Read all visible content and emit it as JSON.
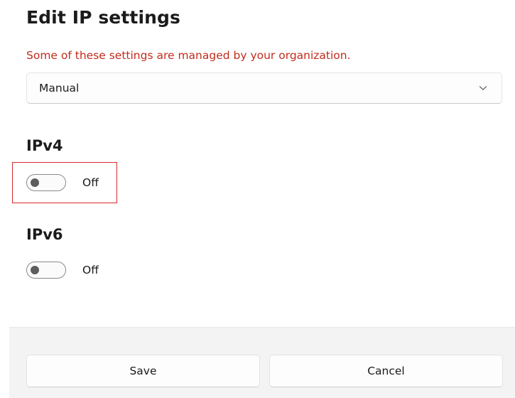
{
  "dialog": {
    "title": "Edit IP settings",
    "policy_note": "Some of these settings are managed by your organization.",
    "mode_dropdown": {
      "selected": "Manual",
      "icon": "chevron-down-icon"
    }
  },
  "ipv4": {
    "heading": "IPv4",
    "toggle_state": "Off"
  },
  "ipv6": {
    "heading": "IPv6",
    "toggle_state": "Off"
  },
  "footer": {
    "save_label": "Save",
    "cancel_label": "Cancel"
  },
  "colors": {
    "warning_text": "#c42b1c",
    "highlight_border": "#d8272b",
    "footer_bg": "#f3f3f3"
  }
}
